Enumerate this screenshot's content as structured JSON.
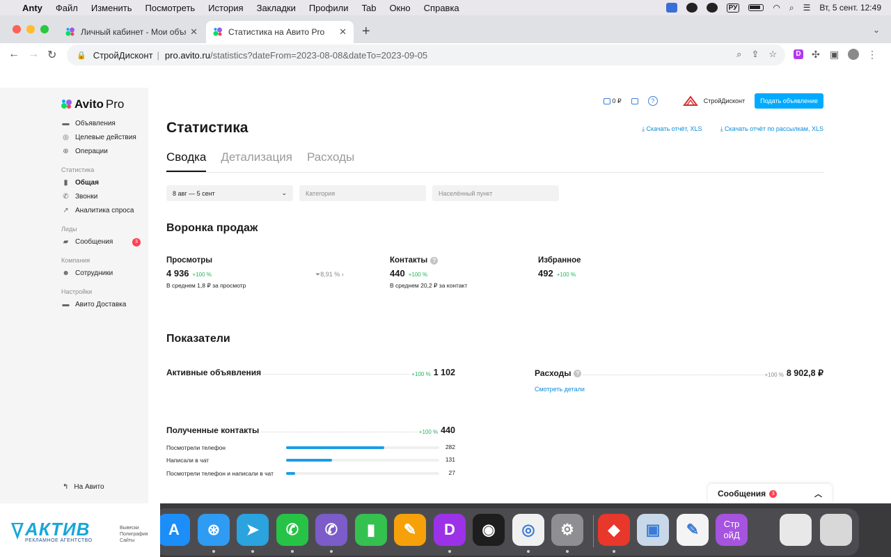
{
  "menubar": {
    "app": "Anty",
    "items": [
      "Файл",
      "Изменить",
      "Посмотреть",
      "История",
      "Закладки",
      "Профили",
      "Tab",
      "Окно",
      "Справка"
    ],
    "lang": "РУ",
    "datetime": "Вт, 5 сент. 12:49"
  },
  "browser": {
    "tabs": [
      {
        "title": "Личный кабинет - Мои объявл"
      },
      {
        "title": "Статистика на Авито Pro"
      }
    ],
    "url_site": "СтройДисконт",
    "url_host": "pro.avito.ru",
    "url_path": "/statistics?dateFrom=2023-08-08&dateTo=2023-09-05"
  },
  "sidebar": {
    "logo_main": "Avito",
    "logo_pro": "Pro",
    "items_top": [
      {
        "label": "Объявления",
        "icon": "listing-icon"
      },
      {
        "label": "Целевые действия",
        "icon": "target-icon"
      },
      {
        "label": "Операции",
        "icon": "ruble-icon"
      }
    ],
    "group_stats": "Статистика",
    "items_stats": [
      {
        "label": "Общая",
        "icon": "bar-chart-icon"
      },
      {
        "label": "Звонки",
        "icon": "phone-icon"
      },
      {
        "label": "Аналитика спроса",
        "icon": "trend-icon"
      }
    ],
    "group_leads": "Лиды",
    "messages_label": "Сообщения",
    "messages_badge": "3",
    "group_company": "Компания",
    "staff_label": "Сотрудники",
    "group_settings": "Настройки",
    "delivery_label": "Авито Доставка",
    "back_label": "На Авито"
  },
  "header": {
    "balance": "0 ₽",
    "help": "?",
    "company_name": "СтройДисконт",
    "post_button": "Подать объявление"
  },
  "page": {
    "title": "Статистика",
    "download_xls": "Скачать отчёт, XLS",
    "download_mailings": "Скачать отчёт по рассылкам, XLS",
    "tabs": [
      "Сводка",
      "Детализация",
      "Расходы"
    ],
    "filters": {
      "date": "8 авг — 5 сент",
      "category_placeholder": "Категория",
      "city_placeholder": "Населённый пункт"
    }
  },
  "funnel": {
    "title": "Воронка продаж",
    "views": {
      "label": "Просмотры",
      "value": "4 936",
      "delta": "+100 %",
      "sub": "В среднем 1,8 ₽ за просмотр"
    },
    "conversion": "8,91 %",
    "contacts": {
      "label": "Контакты",
      "value": "440",
      "delta": "+100 %",
      "sub": "В среднем 20,2 ₽ за контакт"
    },
    "favorites": {
      "label": "Избранное",
      "value": "492",
      "delta": "+100 %"
    }
  },
  "metrics": {
    "title": "Показатели",
    "active_ads": {
      "label": "Активные объявления",
      "delta": "+100 %",
      "value": "1 102"
    },
    "expenses": {
      "label": "Расходы",
      "delta": "+100 %",
      "value": "8 902,8 ₽",
      "link": "Смотреть детали"
    },
    "received_contacts": {
      "label": "Полученные контакты",
      "delta": "+100 %",
      "value": "440"
    },
    "breakdown": [
      {
        "label": "Посмотрели телефон",
        "value": "282",
        "fraction": 0.641
      },
      {
        "label": "Написали в чат",
        "value": "131",
        "fraction": 0.298
      },
      {
        "label": "Посмотрели телефон и написали в чат",
        "value": "27",
        "fraction": 0.061
      }
    ]
  },
  "messages_panel": {
    "label": "Сообщения",
    "badge": "3"
  },
  "watermark": {
    "brand": "АКТИВ",
    "tagline": "РЕКЛАМНОЕ АГЕНТСТВО",
    "services": [
      "Вывески",
      "Полиграфия",
      "Сайты"
    ]
  },
  "dock": {
    "apps": [
      {
        "name": "app-store-icon",
        "color": "#1c8ef9"
      },
      {
        "name": "safari-icon",
        "color": "#2f9bf2"
      },
      {
        "name": "telegram-icon",
        "color": "#2aa3df"
      },
      {
        "name": "whatsapp-icon",
        "color": "#27c346"
      },
      {
        "name": "viber-icon",
        "color": "#7b5cc9"
      },
      {
        "name": "numbers-icon",
        "color": "#34c150"
      },
      {
        "name": "pages-icon",
        "color": "#f6a10a"
      },
      {
        "name": "anty-icon",
        "color": "#9b32e8"
      },
      {
        "name": "figma-icon",
        "color": "#1e1e1e"
      },
      {
        "name": "chrome-icon",
        "color": "#f0f0f0"
      },
      {
        "name": "settings-icon",
        "color": "#8e8e93"
      },
      {
        "name": "anydesk-icon",
        "color": "#e8372b"
      },
      {
        "name": "preview-icon",
        "color": "#c9d8e8"
      },
      {
        "name": "textedit-icon",
        "color": "#f4f4f4"
      },
      {
        "name": "stroy-folder-icon",
        "color": "#a653e0"
      }
    ],
    "folder_label": "Стр ойД"
  }
}
